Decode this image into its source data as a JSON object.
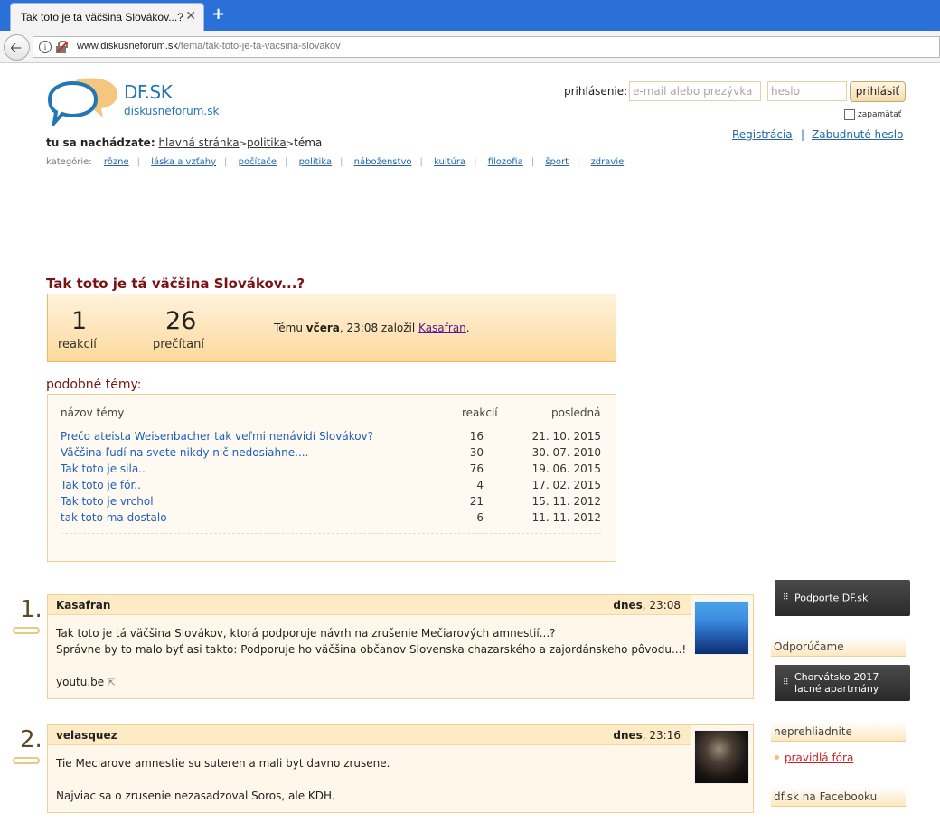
{
  "browser": {
    "tab_title": "Tak toto je tá väčšina Slovákov...?",
    "url_domain": "www.diskusneforum.sk",
    "url_path": "/tema/tak-toto-je-ta-vacsina-slovakov"
  },
  "logo": {
    "title": "DF.SK",
    "subtitle": "diskusneforum.sk"
  },
  "login": {
    "label": "prihlásenie:",
    "email_placeholder": "e-mail alebo prezývka",
    "password_placeholder": "heslo",
    "button": "prihlásiť",
    "remember": "zapamätať",
    "register": "Registrácia",
    "separator": "|",
    "forgot": "Zabudnuté heslo"
  },
  "breadcrumb": {
    "label": "tu sa nachádzate:",
    "home": "hlavná stránka",
    "section": "politika",
    "current": "téma"
  },
  "categories": {
    "label": "kategórie:",
    "items": [
      "rôzne",
      "láska a vzťahy",
      "počítače",
      "politika",
      "náboženstvo",
      "kultúra",
      "filozofia",
      "šport",
      "zdravie"
    ]
  },
  "topic": {
    "title": "Tak toto je tá väčšina Slovákov...?",
    "reactions_count": "1",
    "reactions_label": "reakcií",
    "reads_count": "26",
    "reads_label": "prečítaní",
    "info_prefix": "Tému",
    "info_day": "včera",
    "info_mid": ", 23:08 založil",
    "info_author": "Kasafran",
    "info_end": "."
  },
  "similar": {
    "title": "podobné témy:",
    "col_name": "názov témy",
    "col_count": "reakcií",
    "col_last": "posledná",
    "rows": [
      {
        "name": "Prečo ateista Weisenbacher tak veľmi nenávidí Slovákov?",
        "count": "16",
        "date": "21. 10. 2015"
      },
      {
        "name": "Väčšina ľudí na svete nikdy nič nedosiahne....",
        "count": "30",
        "date": "30. 07. 2010"
      },
      {
        "name": "Tak toto je sila..",
        "count": "76",
        "date": "19. 06. 2015"
      },
      {
        "name": "Tak toto je fór..",
        "count": "4",
        "date": "17. 02. 2015"
      },
      {
        "name": "Tak toto je vrchol",
        "count": "21",
        "date": "15. 11. 2012"
      },
      {
        "name": "tak toto ma dostalo",
        "count": "6",
        "date": "11. 11. 2012"
      }
    ]
  },
  "posts": [
    {
      "number": "1.",
      "author": "Kasafran",
      "date_day": "dnes",
      "date_time": ", 23:08",
      "line1": "Tak toto je tá väčšina Slovákov, ktorá podporuje návrh na zrušenie Mečiarových amnestií...?",
      "line2": "Správne by to malo byť asi takto: Podporuje ho väčšina občanov Slovenska chazarského a zajordánskeho pôvodu...!",
      "link": "youtu.be",
      "avatar": "mountain-landscape"
    },
    {
      "number": "2.",
      "author": "velasquez",
      "date_day": "dnes",
      "date_time": ", 23:16",
      "line1": "Tie Meciarove amnestie su suteren a mali byt davno zrusene.",
      "line2": "Najviac sa o zrusenie nezasadzoval Soros, ale KDH.",
      "avatar": "dark-portrait"
    }
  ],
  "sidebar": {
    "support_btn": "Podporte DF.sk",
    "recommend_title": "Odporúčame",
    "ad_line1": "Chorvátsko 2017",
    "ad_line2": "lacné apartmány",
    "dont_miss_title": "neprehliadnite",
    "rules_link": "pravidlá fóra",
    "facebook_title": "df.sk na Facebooku"
  },
  "colors": {
    "browser_blue": "#2b6fd8",
    "brand_blue": "#2477b3",
    "title_red": "#7a1212",
    "link_blue": "#1f5fb8",
    "stats_orange": "#fcd99c"
  }
}
